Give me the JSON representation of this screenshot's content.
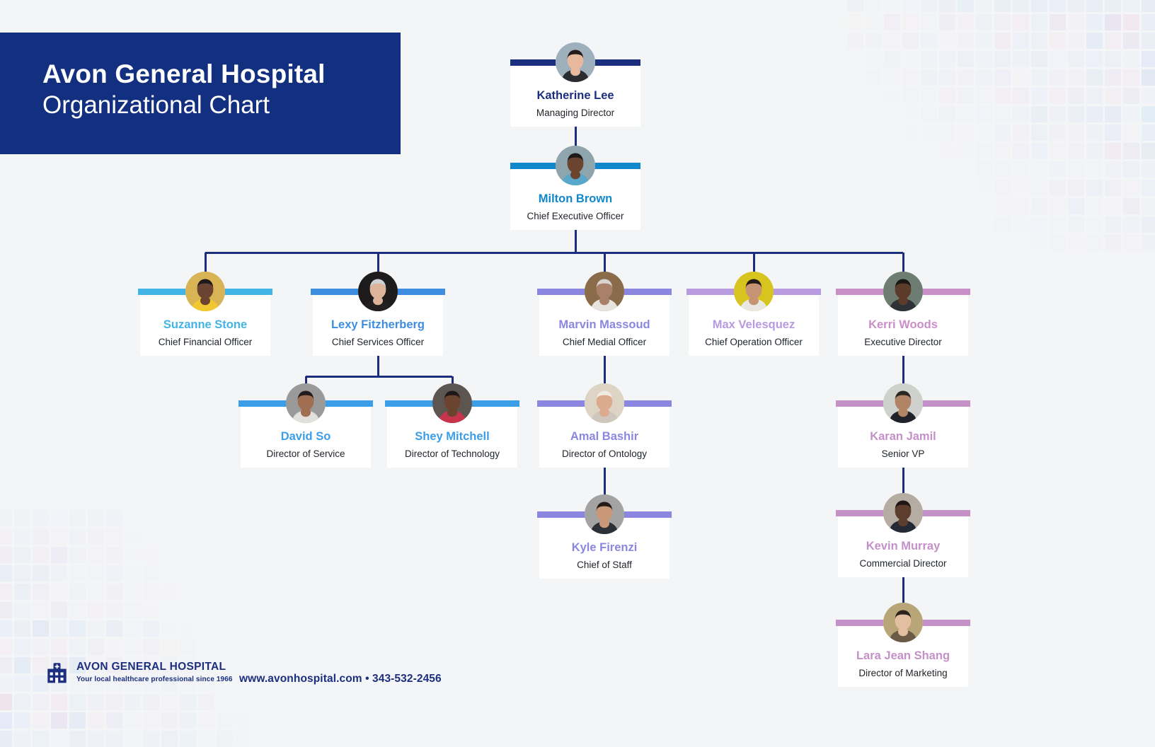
{
  "header": {
    "line1": "Avon General Hospital",
    "line2": "Organizational Chart",
    "bg_color": "#12307f"
  },
  "footer": {
    "logo_name": "AVON GENERAL HOSPITAL",
    "tagline": "Your local healthcare professional since 1966",
    "contact": "www.avonhospital.com • 343-532-2456",
    "logo_icon": "hospital-icon",
    "color": "#1c2f7f"
  },
  "chart_data": {
    "type": "diagram",
    "title": "Avon General Hospital Organizational Chart",
    "connector_color": "#1c2f7f",
    "nodes": [
      {
        "id": "katherine",
        "name": "Katherine Lee",
        "title": "Managing Director",
        "accent": "#1c2f7f",
        "name_color": "#1c2f7f",
        "level": 0,
        "parent": null
      },
      {
        "id": "milton",
        "name": "Milton Brown",
        "title": "Chief Executive Officer",
        "accent": "#1187cc",
        "name_color": "#1187cc",
        "level": 1,
        "parent": "katherine"
      },
      {
        "id": "suzanne",
        "name": "Suzanne Stone",
        "title": "Chief Financial Officer",
        "accent": "#42b4e6",
        "name_color": "#42b4e6",
        "level": 2,
        "parent": "milton"
      },
      {
        "id": "lexy",
        "name": "Lexy Fitzherberg",
        "title": "Chief Services Officer",
        "accent": "#3d8ee0",
        "name_color": "#3d8ee0",
        "level": 2,
        "parent": "milton"
      },
      {
        "id": "marvin",
        "name": "Marvin Massoud",
        "title": "Chief Medial Officer",
        "accent": "#8b87e0",
        "name_color": "#8b87e0",
        "level": 2,
        "parent": "milton"
      },
      {
        "id": "max",
        "name": "Max Velesquez",
        "title": "Chief Operation Officer",
        "accent": "#b79ae0",
        "name_color": "#b79ae0",
        "level": 2,
        "parent": "milton"
      },
      {
        "id": "kerri",
        "name": "Kerri Woods",
        "title": "Executive Director",
        "accent": "#cb8fc8",
        "name_color": "#cb8fc8",
        "level": 2,
        "parent": "milton"
      },
      {
        "id": "david",
        "name": "David So",
        "title": "Director of Service",
        "accent": "#3d9ee8",
        "name_color": "#3d9ee8",
        "level": 3,
        "parent": "lexy"
      },
      {
        "id": "shey",
        "name": "Shey Mitchell",
        "title": "Director of Technology",
        "accent": "#3d9ee8",
        "name_color": "#3d9ee8",
        "level": 3,
        "parent": "lexy"
      },
      {
        "id": "amal",
        "name": "Amal Bashir",
        "title": "Director of Ontology",
        "accent": "#8b87e0",
        "name_color": "#8b87e0",
        "level": 3,
        "parent": "marvin"
      },
      {
        "id": "kyle",
        "name": "Kyle Firenzi",
        "title": "Chief of Staff",
        "accent": "#8b87e0",
        "name_color": "#8b87e0",
        "level": 4,
        "parent": "amal"
      },
      {
        "id": "karan",
        "name": "Karan Jamil",
        "title": "Senior VP",
        "accent": "#c490c8",
        "name_color": "#c490c8",
        "level": 3,
        "parent": "kerri"
      },
      {
        "id": "kevin",
        "name": "Kevin Murray",
        "title": "Commercial Director",
        "accent": "#c490c8",
        "name_color": "#c490c8",
        "level": 4,
        "parent": "karan"
      },
      {
        "id": "lara",
        "name": "Lara Jean Shang",
        "title": "Director of Marketing",
        "accent": "#c490c8",
        "name_color": "#c490c8",
        "level": 5,
        "parent": "kevin"
      }
    ]
  }
}
